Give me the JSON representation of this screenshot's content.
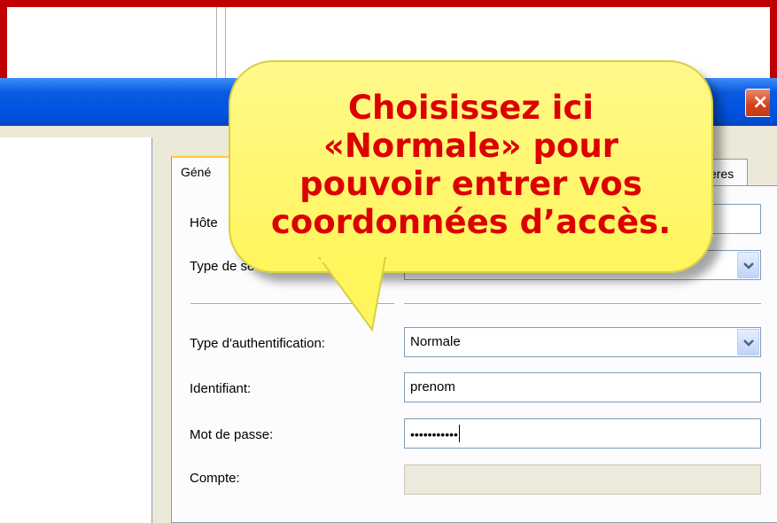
{
  "window": {
    "close_glyph": "×"
  },
  "tabs": [
    {
      "label": "Géné"
    },
    {
      "label": "eres"
    }
  ],
  "form": {
    "host_label": "Hôte",
    "server_type_label": "Type de se",
    "auth_type_label": "Type d'authentification:",
    "auth_type_value": "Normale",
    "identifier_label": "Identifiant:",
    "identifier_value": "prenom",
    "password_label": "Mot de passe:",
    "password_value": "•••••••••••",
    "account_label": "Compte:",
    "account_value": ""
  },
  "callout": {
    "line1": "Choisissez ici",
    "line2": "«Normale» pour",
    "line3": "pouvoir entrer vos",
    "line4": "coordonnées d’accès."
  },
  "colors": {
    "frame_border": "#c00000",
    "callout_fill": "#fff55c",
    "callout_text": "#dd0000",
    "titlebar": "#0054e3"
  }
}
